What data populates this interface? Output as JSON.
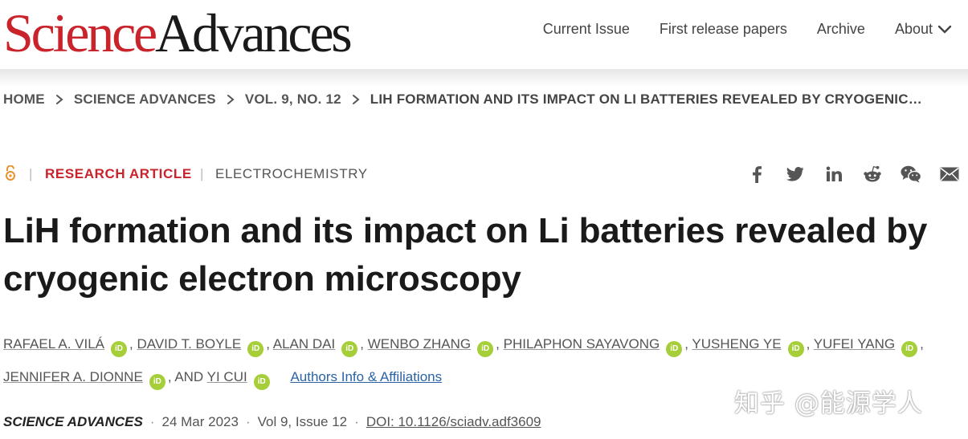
{
  "header": {
    "logo_part1": "Science",
    "logo_part2": "Advances",
    "nav": [
      "Current Issue",
      "First release papers",
      "Archive",
      "About"
    ]
  },
  "breadcrumb": [
    "HOME",
    "SCIENCE ADVANCES",
    "VOL. 9, NO. 12",
    "LIH FORMATION AND ITS IMPACT ON LI BATTERIES REVEALED BY CRYOGENIC…"
  ],
  "meta": {
    "article_type": "RESEARCH ARTICLE",
    "subject": "ELECTROCHEMISTRY",
    "pipe": "|"
  },
  "share_icons": [
    "facebook-icon",
    "twitter-icon",
    "linkedin-icon",
    "reddit-icon",
    "wechat-icon",
    "email-icon"
  ],
  "article": {
    "title": "LiH formation and its impact on Li batteries revealed by cryogenic electron microscopy"
  },
  "authors": {
    "list": [
      "RAFAEL A. VILÁ",
      "DAVID T. BOYLE",
      "ALAN DAI",
      "WENBO ZHANG",
      "PHILAPHON SAYAVONG",
      "YUSHENG YE",
      "YUFEI YANG",
      "JENNIFER A. DIONNE",
      "YI CUI"
    ],
    "orcid_label": "iD",
    "separator": ",",
    "and_text": ", AND",
    "affiliations_link": "Authors Info & Affiliations"
  },
  "citation": {
    "journal": "SCIENCE ADVANCES",
    "date": "24 Mar 2023",
    "volume": "Vol 9, Issue 12",
    "doi": "DOI: 10.1126/sciadv.adf3609",
    "dot": "·"
  },
  "watermark": "知乎 @能源学人",
  "colors": {
    "brand_red": "#c9232b",
    "link_blue": "#2a63a8",
    "orcid_green": "#a6ce39"
  }
}
